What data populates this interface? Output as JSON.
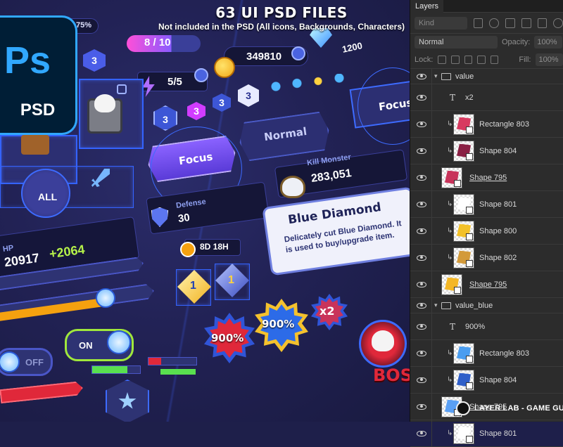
{
  "banner": {
    "title": "63 UI PSD FILES",
    "subtitle": "Not included in the PSD (All icons, Backgrounds, Characters)"
  },
  "ps_logo": {
    "letters": "Ps",
    "caption": "PSD"
  },
  "game_ui": {
    "top_percent": "75%",
    "level_badge": "3",
    "xp_bar": "8 / 10",
    "coins": "349810",
    "gems": "1200",
    "energy": "5/5",
    "shield_badges": [
      "3",
      "3",
      "3",
      "3"
    ],
    "focus_button": "Focus",
    "normal_button": "Normal",
    "focus_button_right": "Focus",
    "all_tab": "ALL",
    "kill_monster_label": "Kill Monster",
    "kill_monster_value": "283,051",
    "defense_label": "Defense",
    "defense_value": "30",
    "hp_label": "HP",
    "hp_value": "20917",
    "hp_bonus": "+2064",
    "timer": "8D 18H",
    "ticket_1": "1",
    "ticket_2": "1",
    "tooltip_title": "Blue Diamond",
    "tooltip_desc": "Delicately cut Blue Diamond. It is used to buy/upgrade item.",
    "burst_red": "900%",
    "burst_blue": "900%",
    "burst_x2": "x2",
    "toggle_off": "OFF",
    "toggle_on": "ON",
    "boss_label": "BOS"
  },
  "layers_panel": {
    "tab": "Layers",
    "kind_placeholder": "Kind",
    "blend_mode": "Normal",
    "opacity_label": "Opacity:",
    "opacity_value": "100%",
    "lock_label": "Lock:",
    "fill_label": "Fill:",
    "fill_value": "100%",
    "layers": [
      {
        "type": "group",
        "name": "value"
      },
      {
        "type": "text",
        "name": "x2"
      },
      {
        "type": "shape",
        "name": "Rectangle 803",
        "clipped": true,
        "color": "#d83a60"
      },
      {
        "type": "shape",
        "name": "Shape 804",
        "clipped": true,
        "color": "#8a2044"
      },
      {
        "type": "shape",
        "name": "Shape 795",
        "clipped": false,
        "color": "#c8335a"
      },
      {
        "type": "shape",
        "name": "Shape 801",
        "clipped": true,
        "color": "#ffffff"
      },
      {
        "type": "shape",
        "name": "Shape 800",
        "clipped": true,
        "color": "#f3c129"
      },
      {
        "type": "shape",
        "name": "Shape 802",
        "clipped": true,
        "color": "#d39a3a"
      },
      {
        "type": "shape",
        "name": "Shape 795",
        "clipped": false,
        "color": "#f4b726"
      },
      {
        "type": "group",
        "name": "value_blue"
      },
      {
        "type": "text",
        "name": "900%"
      },
      {
        "type": "shape",
        "name": "Rectangle 803",
        "clipped": true,
        "color": "#4a9df0"
      },
      {
        "type": "shape",
        "name": "Shape 804",
        "clipped": true,
        "color": "#2f5fc9"
      },
      {
        "type": "shape",
        "name": "Shape 795",
        "clipped": false,
        "color": "#5aa0f5"
      },
      {
        "type": "shape",
        "name": "Shape 801",
        "clipped": true,
        "color": "#ffffff"
      }
    ]
  },
  "watermark": "LAYER LAB - GAME GUI",
  "colors": {
    "ps_blue": "#31a8ff",
    "ps_dark": "#001e36",
    "frame_blue": "#3463ff",
    "panel_bg": "#2c2c2c",
    "hp_green": "#b6f24a",
    "bar_orange": "#f5a10f"
  }
}
